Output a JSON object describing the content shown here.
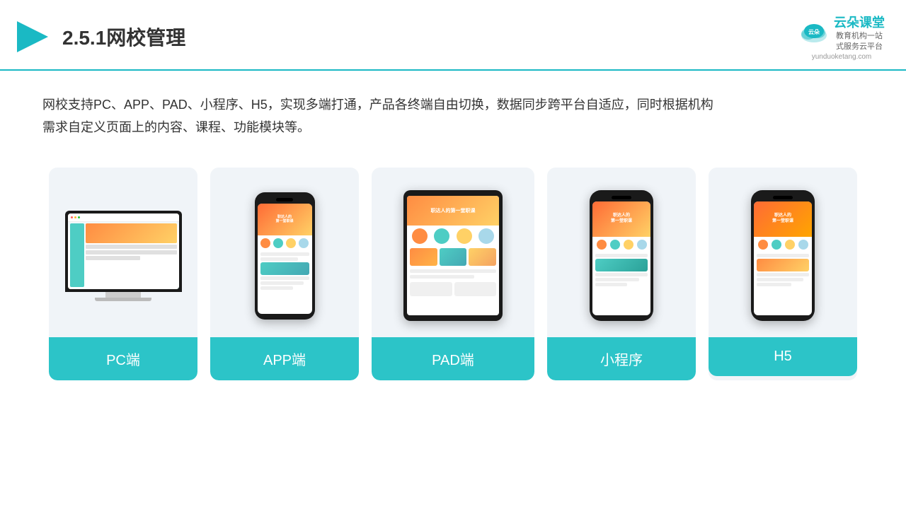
{
  "header": {
    "title": "2.5.1网校管理",
    "logo_name": "云朵课堂",
    "logo_url": "yunduoketang.com",
    "logo_tagline": "教育机构一站\n式服务云平台"
  },
  "description": {
    "text1": "网校支持PC、APP、PAD、小程序、H5，实现多端打通，产品各终端自由切换，数据同步跨平台自适应，同时根据机构",
    "text2": "需求自定义页面上的内容、课程、功能模块等。"
  },
  "cards": [
    {
      "id": "pc",
      "label": "PC端"
    },
    {
      "id": "app",
      "label": "APP端"
    },
    {
      "id": "pad",
      "label": "PAD端"
    },
    {
      "id": "miniprogram",
      "label": "小程序"
    },
    {
      "id": "h5",
      "label": "H5"
    }
  ]
}
